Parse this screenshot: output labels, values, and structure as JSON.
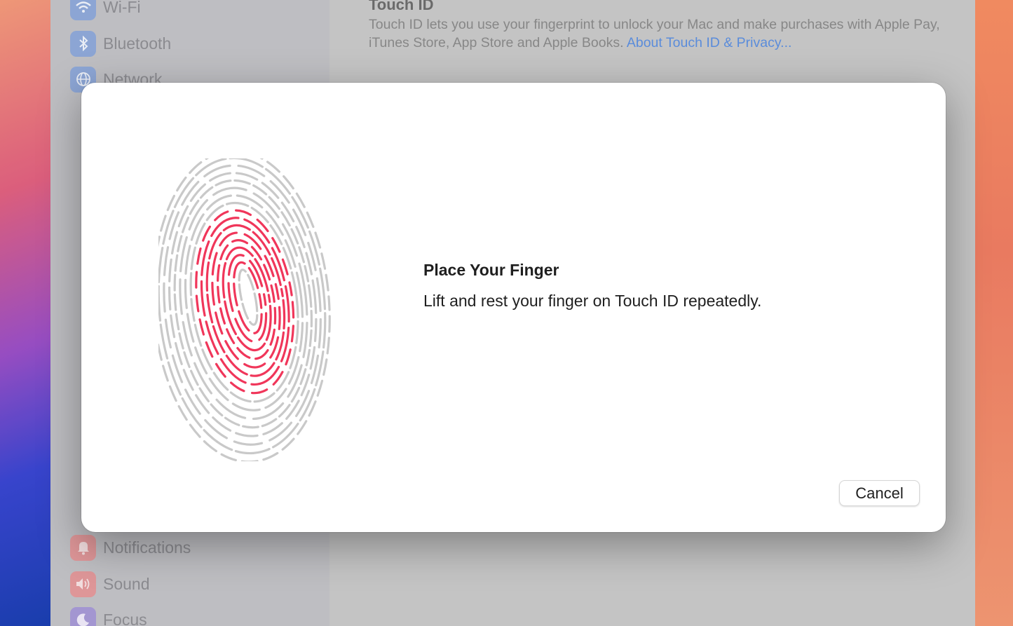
{
  "sidebar": {
    "items": [
      {
        "label": "Wi-Fi",
        "icon": "wifi-icon",
        "color": "#8fa9d9"
      },
      {
        "label": "Bluetooth",
        "icon": "bluetooth-icon",
        "color": "#8fa9d9"
      },
      {
        "label": "Network",
        "icon": "globe-icon",
        "color": "#8fa9d9"
      },
      {
        "label": "Notifications",
        "icon": "bell-icon",
        "color": "#e39a9c"
      },
      {
        "label": "Sound",
        "icon": "speaker-icon",
        "color": "#e39a9c"
      },
      {
        "label": "Focus",
        "icon": "moon-icon",
        "color": "#a79ad6"
      }
    ]
  },
  "content": {
    "title": "Touch ID",
    "description": "Touch ID lets you use your fingerprint to unlock your Mac and make purchases with Apple Pay, iTunes Store, App Store and Apple Books.",
    "link": "About Touch ID & Privacy..."
  },
  "sheet": {
    "title": "Place Your Finger",
    "description": "Lift and rest your finger on Touch ID repeatedly.",
    "cancel_label": "Cancel",
    "accent_color": "#f0365a",
    "ridge_color": "#c9c9c9"
  }
}
